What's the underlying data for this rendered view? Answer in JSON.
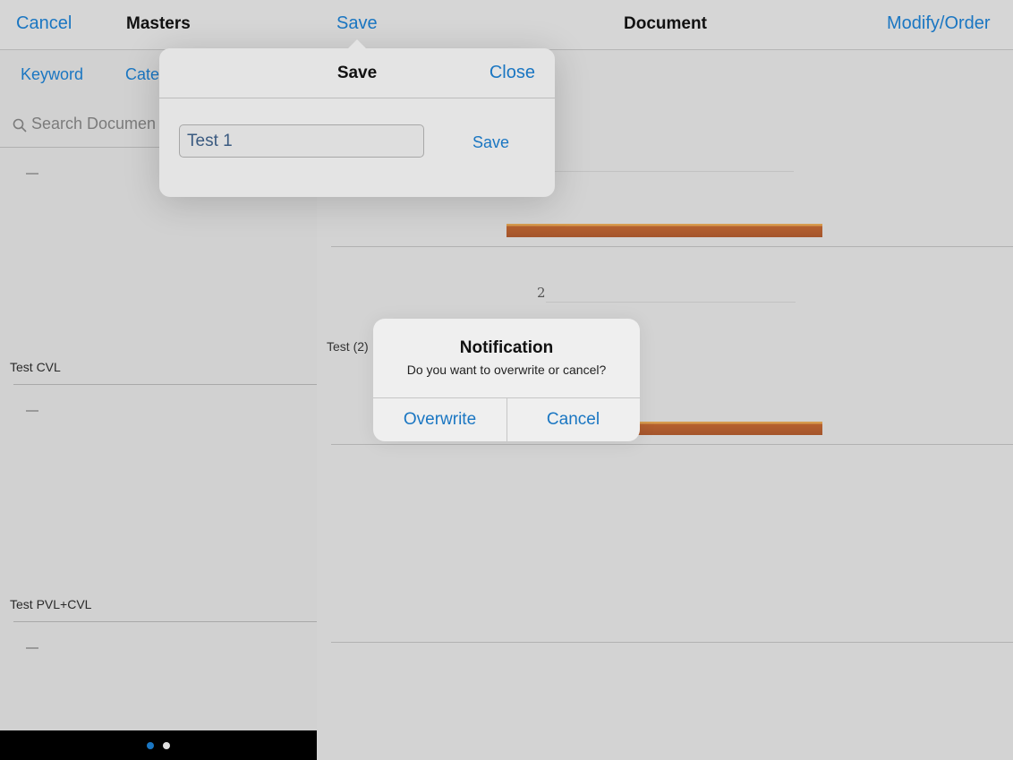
{
  "navbar": {
    "cancel_label": "Cancel",
    "masters_title": "Masters",
    "save_label": "Save",
    "document_title": "Document",
    "modify_label": "Modify/Order"
  },
  "sidebar": {
    "tabs": [
      "Keyword",
      "Cate"
    ],
    "search_placeholder": "Search Documen",
    "items": [
      {
        "label": "Test CVL"
      },
      {
        "label": "Test PVL+CVL"
      }
    ],
    "page_dots": {
      "count": 2,
      "active": 1
    }
  },
  "document": {
    "value_label": "2",
    "row_label": "Test (2)"
  },
  "save_popover": {
    "title": "Save",
    "close_label": "Close",
    "name_value": "Test 1",
    "save_label": "Save"
  },
  "alert": {
    "title": "Notification",
    "message": "Do you want to overwrite or cancel?",
    "overwrite_label": "Overwrite",
    "cancel_label": "Cancel"
  },
  "colors": {
    "accent": "#1a76c2",
    "bar": "#a4552c"
  }
}
